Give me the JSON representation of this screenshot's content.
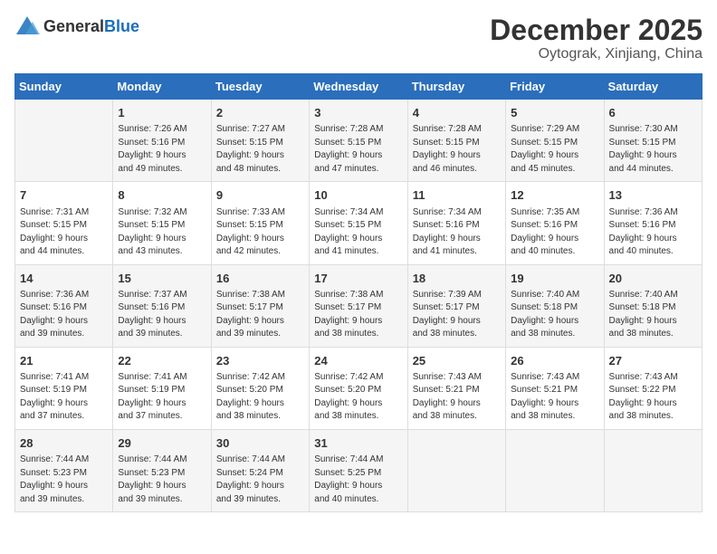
{
  "logo": {
    "general": "General",
    "blue": "Blue"
  },
  "header": {
    "month": "December 2025",
    "location": "Oytograk, Xinjiang, China"
  },
  "days_of_week": [
    "Sunday",
    "Monday",
    "Tuesday",
    "Wednesday",
    "Thursday",
    "Friday",
    "Saturday"
  ],
  "weeks": [
    [
      {
        "day": "",
        "info": ""
      },
      {
        "day": "1",
        "info": "Sunrise: 7:26 AM\nSunset: 5:16 PM\nDaylight: 9 hours\nand 49 minutes."
      },
      {
        "day": "2",
        "info": "Sunrise: 7:27 AM\nSunset: 5:15 PM\nDaylight: 9 hours\nand 48 minutes."
      },
      {
        "day": "3",
        "info": "Sunrise: 7:28 AM\nSunset: 5:15 PM\nDaylight: 9 hours\nand 47 minutes."
      },
      {
        "day": "4",
        "info": "Sunrise: 7:28 AM\nSunset: 5:15 PM\nDaylight: 9 hours\nand 46 minutes."
      },
      {
        "day": "5",
        "info": "Sunrise: 7:29 AM\nSunset: 5:15 PM\nDaylight: 9 hours\nand 45 minutes."
      },
      {
        "day": "6",
        "info": "Sunrise: 7:30 AM\nSunset: 5:15 PM\nDaylight: 9 hours\nand 44 minutes."
      }
    ],
    [
      {
        "day": "7",
        "info": "Sunrise: 7:31 AM\nSunset: 5:15 PM\nDaylight: 9 hours\nand 44 minutes."
      },
      {
        "day": "8",
        "info": "Sunrise: 7:32 AM\nSunset: 5:15 PM\nDaylight: 9 hours\nand 43 minutes."
      },
      {
        "day": "9",
        "info": "Sunrise: 7:33 AM\nSunset: 5:15 PM\nDaylight: 9 hours\nand 42 minutes."
      },
      {
        "day": "10",
        "info": "Sunrise: 7:34 AM\nSunset: 5:15 PM\nDaylight: 9 hours\nand 41 minutes."
      },
      {
        "day": "11",
        "info": "Sunrise: 7:34 AM\nSunset: 5:16 PM\nDaylight: 9 hours\nand 41 minutes."
      },
      {
        "day": "12",
        "info": "Sunrise: 7:35 AM\nSunset: 5:16 PM\nDaylight: 9 hours\nand 40 minutes."
      },
      {
        "day": "13",
        "info": "Sunrise: 7:36 AM\nSunset: 5:16 PM\nDaylight: 9 hours\nand 40 minutes."
      }
    ],
    [
      {
        "day": "14",
        "info": "Sunrise: 7:36 AM\nSunset: 5:16 PM\nDaylight: 9 hours\nand 39 minutes."
      },
      {
        "day": "15",
        "info": "Sunrise: 7:37 AM\nSunset: 5:16 PM\nDaylight: 9 hours\nand 39 minutes."
      },
      {
        "day": "16",
        "info": "Sunrise: 7:38 AM\nSunset: 5:17 PM\nDaylight: 9 hours\nand 39 minutes."
      },
      {
        "day": "17",
        "info": "Sunrise: 7:38 AM\nSunset: 5:17 PM\nDaylight: 9 hours\nand 38 minutes."
      },
      {
        "day": "18",
        "info": "Sunrise: 7:39 AM\nSunset: 5:17 PM\nDaylight: 9 hours\nand 38 minutes."
      },
      {
        "day": "19",
        "info": "Sunrise: 7:40 AM\nSunset: 5:18 PM\nDaylight: 9 hours\nand 38 minutes."
      },
      {
        "day": "20",
        "info": "Sunrise: 7:40 AM\nSunset: 5:18 PM\nDaylight: 9 hours\nand 38 minutes."
      }
    ],
    [
      {
        "day": "21",
        "info": "Sunrise: 7:41 AM\nSunset: 5:19 PM\nDaylight: 9 hours\nand 37 minutes."
      },
      {
        "day": "22",
        "info": "Sunrise: 7:41 AM\nSunset: 5:19 PM\nDaylight: 9 hours\nand 37 minutes."
      },
      {
        "day": "23",
        "info": "Sunrise: 7:42 AM\nSunset: 5:20 PM\nDaylight: 9 hours\nand 38 minutes."
      },
      {
        "day": "24",
        "info": "Sunrise: 7:42 AM\nSunset: 5:20 PM\nDaylight: 9 hours\nand 38 minutes."
      },
      {
        "day": "25",
        "info": "Sunrise: 7:43 AM\nSunset: 5:21 PM\nDaylight: 9 hours\nand 38 minutes."
      },
      {
        "day": "26",
        "info": "Sunrise: 7:43 AM\nSunset: 5:21 PM\nDaylight: 9 hours\nand 38 minutes."
      },
      {
        "day": "27",
        "info": "Sunrise: 7:43 AM\nSunset: 5:22 PM\nDaylight: 9 hours\nand 38 minutes."
      }
    ],
    [
      {
        "day": "28",
        "info": "Sunrise: 7:44 AM\nSunset: 5:23 PM\nDaylight: 9 hours\nand 39 minutes."
      },
      {
        "day": "29",
        "info": "Sunrise: 7:44 AM\nSunset: 5:23 PM\nDaylight: 9 hours\nand 39 minutes."
      },
      {
        "day": "30",
        "info": "Sunrise: 7:44 AM\nSunset: 5:24 PM\nDaylight: 9 hours\nand 39 minutes."
      },
      {
        "day": "31",
        "info": "Sunrise: 7:44 AM\nSunset: 5:25 PM\nDaylight: 9 hours\nand 40 minutes."
      },
      {
        "day": "",
        "info": ""
      },
      {
        "day": "",
        "info": ""
      },
      {
        "day": "",
        "info": ""
      }
    ]
  ]
}
